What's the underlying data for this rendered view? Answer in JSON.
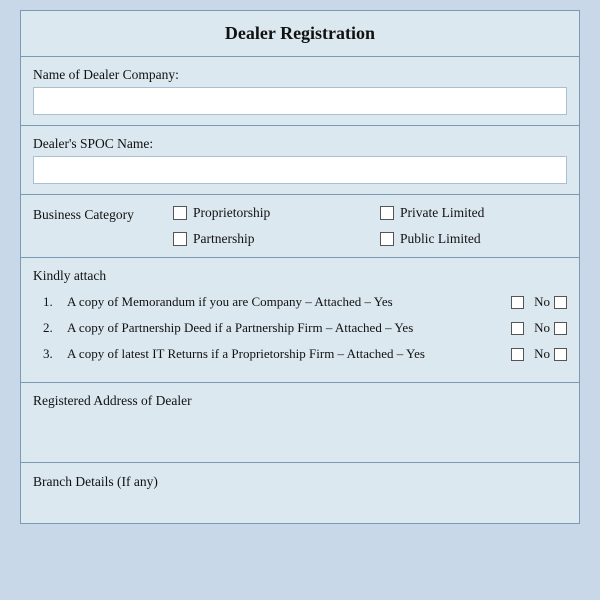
{
  "title": "Dealer Registration",
  "fields": {
    "dealer_company_label": "Name of Dealer Company:",
    "spoc_label": "Dealer's SPOC Name:",
    "business_category_label": "Business Category"
  },
  "business_options": [
    {
      "id": "proprietorship",
      "label": "Proprietorship"
    },
    {
      "id": "private-limited",
      "label": "Private Limited"
    },
    {
      "id": "partnership",
      "label": "Partnership"
    },
    {
      "id": "public-limited",
      "label": "Public Limited"
    }
  ],
  "kindly_attach": {
    "title": "Kindly attach",
    "items": [
      {
        "number": "1.",
        "text": "A copy of Memorandum if you are Company – Attached – Yes",
        "no_label": "No"
      },
      {
        "number": "2.",
        "text": "A copy of Partnership Deed if a Partnership Firm – Attached – Yes",
        "no_label": "No"
      },
      {
        "number": "3.",
        "text": "A copy of latest IT Returns if a Proprietorship Firm – Attached – Yes",
        "no_label": "No"
      }
    ]
  },
  "registered_address_label": "Registered Address of Dealer",
  "branch_details_label": "Branch Details (If any)"
}
